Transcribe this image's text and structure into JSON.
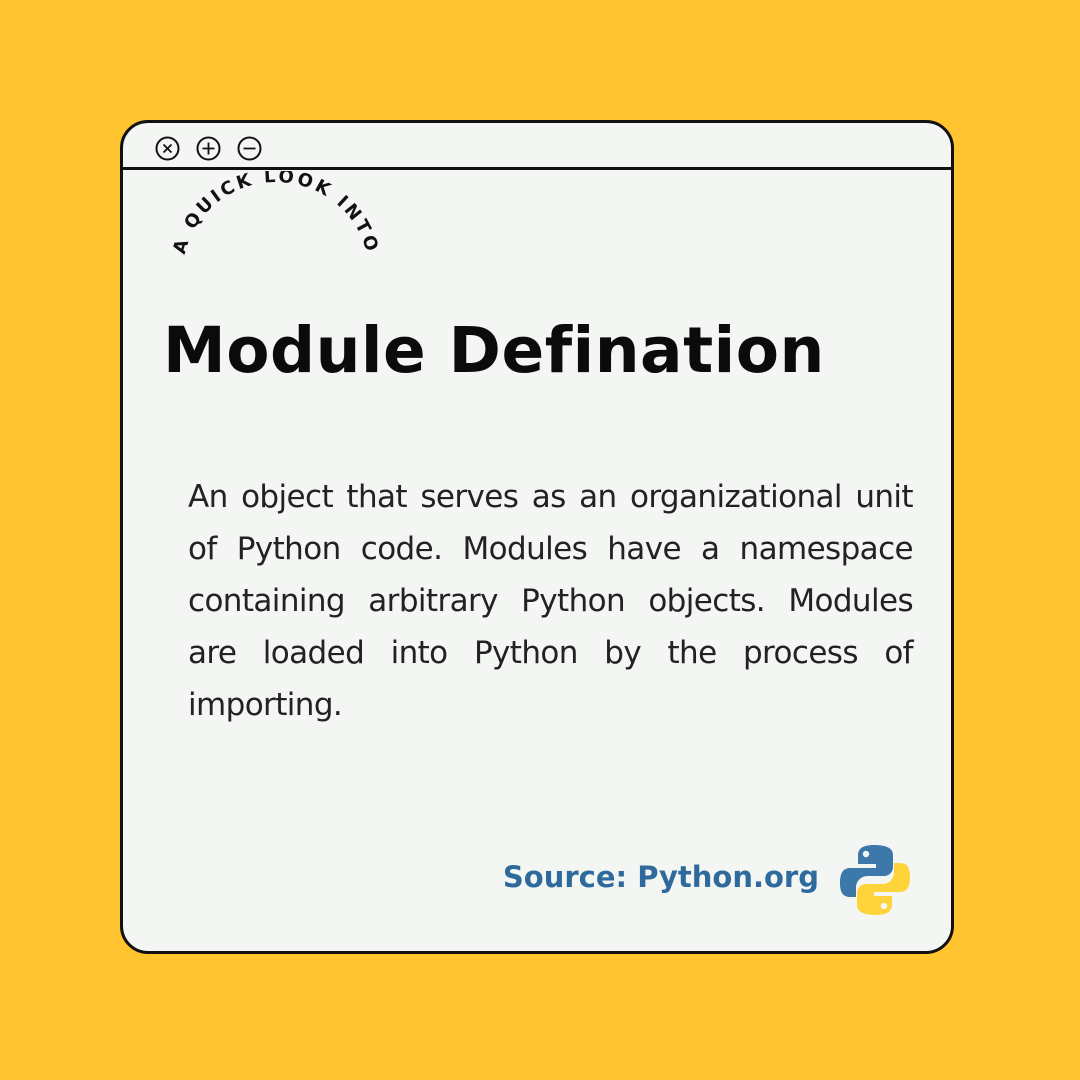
{
  "window": {
    "controls": [
      {
        "name": "close-icon",
        "symbol": "×"
      },
      {
        "name": "plus-icon",
        "symbol": "+"
      },
      {
        "name": "minus-icon",
        "symbol": "−"
      }
    ]
  },
  "kicker": "A QUICK LOOK INTO",
  "title": "Module Defination",
  "body": "An object that serves as an organizational unit of Python code. Modules have a namespace containing arbitrary Python objects. Modules are loaded into Python by the process of importing.",
  "source": "Source: Python.org",
  "logo": "python-logo-icon",
  "colors": {
    "background": "#FFC42F",
    "window": "#F4F6F4",
    "source_text": "#2F6A9C",
    "python_blue": "#3C78AA",
    "python_yellow": "#FFD43B"
  }
}
